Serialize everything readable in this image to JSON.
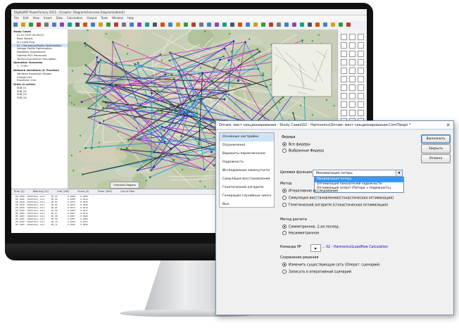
{
  "app": {
    "title": "DIgSILENT PowerFactory 2015 - [Graphic: Diagram\\Overview Diagram(edited)]",
    "menu": [
      "File",
      "Edit",
      "View",
      "Insert",
      "Data",
      "Calculation",
      "Output",
      "Tools",
      "Window",
      "Help"
    ],
    "tree": [
      {
        "text": "Study Cases",
        "hdr": true
      },
      {
        "text": "01.01.2015 00:00:00"
      },
      {
        "text": "Base Models"
      },
      {
        "text": "N-1 Load Flow"
      },
      {
        "text": "02 - Harmonics/Power Optimisation",
        "hl": true
      },
      {
        "text": "Voltage Profile Optimisation"
      },
      {
        "text": "Reliability Assessment"
      },
      {
        "text": "Optimal RCS Placement"
      },
      {
        "text": "Techno-Economical Calculation"
      },
      {
        "text": "Operation Scenarios",
        "hdr": true
      },
      {
        "text": "2 - TOPO"
      },
      {
        "text": "Network Variations (0, Fraction)",
        "hdr": true
      },
      {
        "text": "Variation Expansion Stages"
      },
      {
        "text": "Charge Line"
      },
      {
        "text": "Expansion Line"
      },
      {
        "text": "Grids (4 active)",
        "hdr": true
      },
      {
        "text": "SUB_01"
      },
      {
        "text": "SUB_02"
      },
      {
        "text": "SUB_03"
      },
      {
        "text": "SUB_04"
      }
    ],
    "grid_tabs": [
      "Error (0)",
      "Warning (11)",
      "Info (160)",
      "Event (0)",
      "Other (300)",
      "Out of Filter"
    ],
    "grid_rows": [
      "DE_1000  CROSSTALL_Tu11     PQ_01        0.9999    0.9909",
      "DE_1000  CROSSTALL_Tu11     PQ_02        0.9998    0.9912",
      "DE_1000  CROSSTALL_Tu11     PQ_03        0.9876    0.9915",
      "DE_1000  CROSSTALL_Tu11     PQ_04        0.9876    0.9909",
      "DE_1000  CROSSTALL_Tu11     PQ_05        0.9876    0.9919",
      "DE_1000  CROSSTALL_Tu11     PQ_06        0.9895    0.9917",
      "DE_1000  CROSSTALL_Tu11     PQ_07        0.9857    0.9914",
      "DE_1000  CROSSTALL_Tu11     PQ_08        0.9857    0.9909",
      "DE_1000  CROSSTALL_Tu11     PQ_09        0.9857    0.9905",
      "DE_1000  CROSSTALL_Tu11     PQ_10        0.9850    0.9901",
      "DE_1000  CROSSTALL_Tu11     PQ_11        0.9846    0.9899"
    ],
    "map_tab": "Overview Diagram"
  },
  "dialog": {
    "title": "Оптим. мест секционирования - Study Cases\\02 - Harmonics\\Оптим. мест секционирования.ComTieopt *",
    "nav": [
      "Основные настройки",
      "Ограничения",
      "Варианты переключение",
      "Надежность",
      "Исследование замкнутости",
      "Симуляция восстановления",
      "Генетический алгоритм",
      "Генерация случайных чисел",
      "Вых."
    ],
    "feeders_label": "Фидера",
    "feeders_all": "Все фидеры",
    "feeders_selected": "Выбранные Фидера",
    "target_label": "Целевая функция",
    "target_value": "Минимизация потерь",
    "target_options": [
      "Минимизация потерь",
      "Оптимизация показателей надежности",
      "Оптимизация затрат (Потери + Надежность)"
    ],
    "method_label": "Метод",
    "method_options": [
      "Итеративное исследование",
      "Симуляция восстановления(стохастическая оптимизация)",
      "Генетический алгоритм (стохастическая оптимизация)"
    ],
    "calc_label": "Метод расчета",
    "calc_options": [
      "Симметричнoе, 1-ая послед.",
      "Несимметричное"
    ],
    "command_label": "Команда УР",
    "command_value": "... 02 - Harmonics\\Loadflow Calculation",
    "save_label": "Сохранение решения",
    "save_options": [
      "Изменить существующую сеть (Операт. сценарий)",
      "Записать в оперативный сценарий"
    ],
    "buttons": {
      "run": "Выполнить",
      "close": "Закрыть",
      "cancel": "Отмена"
    }
  },
  "colors": {
    "nav_selected": "#cfe3f7",
    "dropdown_selected": "#3399ff",
    "link": "#0000cc"
  }
}
